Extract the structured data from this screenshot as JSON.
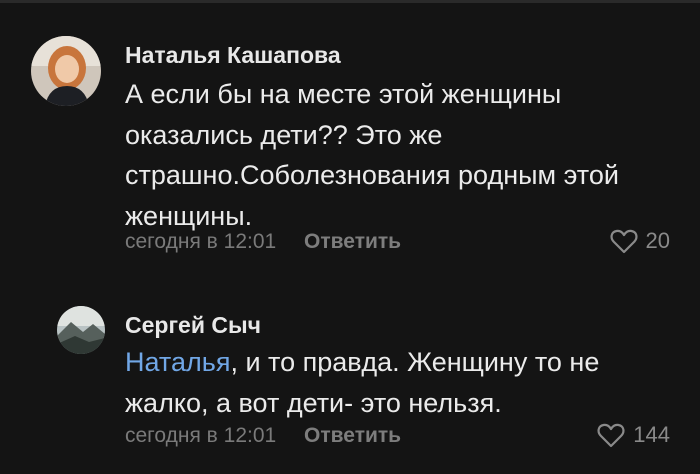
{
  "comments": [
    {
      "author": "Наталья Кашапова",
      "text": "А если бы на месте этой женщины оказались дети?? Это же страшно.Соболезнования родным этой женщины.",
      "time": "сегодня в 12:01",
      "reply_label": "Ответить",
      "likes": "20",
      "avatar_icon": "user-photo-avatar"
    },
    {
      "author": "Сергей Сыч",
      "mention": "Наталья",
      "text": ", и то правда. Женщину то не жалко, а вот дети- это нельзя.",
      "time": "сегодня в 12:01",
      "reply_label": "Ответить",
      "likes": "144",
      "avatar_icon": "landscape-photo-avatar"
    }
  ],
  "colors": {
    "background": "#141414",
    "text": "#ebebeb",
    "muted": "#7a7a7a",
    "mention": "#71a7e6"
  }
}
